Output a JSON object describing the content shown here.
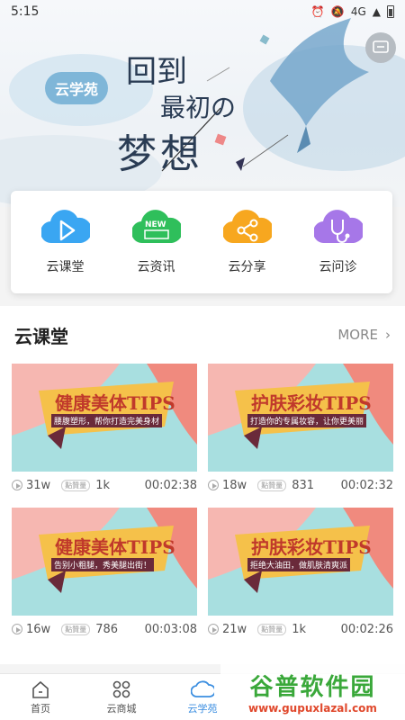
{
  "status_bar": {
    "time": "5:15",
    "network": "4G"
  },
  "hero": {
    "badge": "云学苑",
    "line1": "回到",
    "line2": "最初の",
    "line3": "梦想"
  },
  "quick_menu": [
    {
      "label": "云课堂",
      "icon": "play-cloud-icon",
      "color": "#3aa6f2"
    },
    {
      "label": "云资讯",
      "icon": "news-cloud-icon",
      "color": "#2fbf5b",
      "badge": "NEW"
    },
    {
      "label": "云分享",
      "icon": "share-cloud-icon",
      "color": "#f7a71f"
    },
    {
      "label": "云问诊",
      "icon": "stethoscope-cloud-icon",
      "color": "#a677e8"
    }
  ],
  "section": {
    "title": "云课堂",
    "more": "MORE"
  },
  "courses": [
    {
      "title": "健康美体TIPS",
      "subtitle": "腰腹塑形，帮你打造完美身材",
      "views": "31w",
      "likes": "1k",
      "duration": "00:02:38"
    },
    {
      "title": "护肤彩妆TIPS",
      "subtitle": "打造你的专属妆容，让你更美丽",
      "views": "18w",
      "likes": "831",
      "duration": "00:02:32"
    },
    {
      "title": "健康美体TIPS",
      "subtitle": "告别小粗腿，秀美腿出街！",
      "views": "16w",
      "likes": "786",
      "duration": "00:03:08"
    },
    {
      "title": "护肤彩妆TIPS",
      "subtitle": "拒绝大油田，做肌肤清爽派",
      "views": "21w",
      "likes": "1k",
      "duration": "00:02:26"
    }
  ],
  "likes_badge": "點贊量",
  "tabs": [
    {
      "label": "首页",
      "icon": "home-icon"
    },
    {
      "label": "云商城",
      "icon": "mall-icon"
    },
    {
      "label": "云学苑",
      "icon": "cloud-icon",
      "active": true
    }
  ],
  "watermark": {
    "main": "谷普软件园",
    "sub": "www.gupuxlazal.com"
  }
}
